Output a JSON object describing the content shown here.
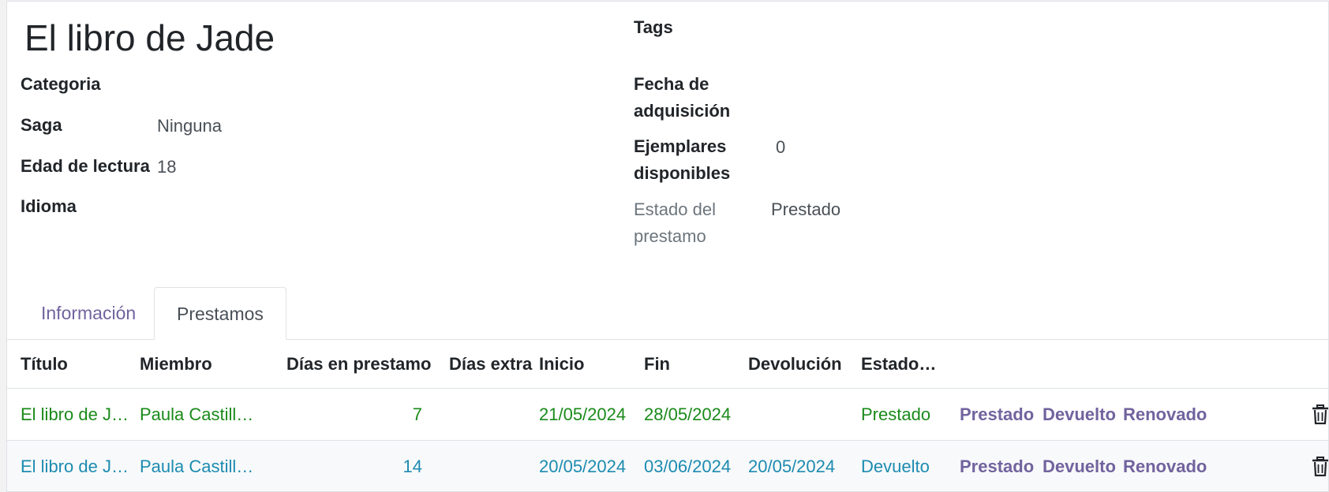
{
  "record": {
    "title": "El libro de Jade"
  },
  "fields_left": {
    "categoria_label": "Categoria",
    "saga_label": "Saga",
    "saga_value": "Ninguna",
    "edad_label": "Edad de lectura",
    "edad_value": "18",
    "idioma_label": "Idioma"
  },
  "fields_right": {
    "tags_label": "Tags",
    "fecha_label_1": "Fecha de",
    "fecha_label_2": "adquisición",
    "ejemplares_label_1": "Ejemplares",
    "ejemplares_label_2": "disponibles",
    "ejemplares_value": "0",
    "estado_label_1": "Estado del",
    "estado_label_2": "prestamo",
    "estado_value": "Prestado"
  },
  "tabs": [
    {
      "label": "Información",
      "active": false
    },
    {
      "label": "Prestamos",
      "active": true
    }
  ],
  "table": {
    "headers": [
      "Título",
      "Miembro",
      "Días en prestamo",
      "Días extra",
      "Inicio",
      "Fin",
      "Devolución",
      "Estado…"
    ],
    "rows": [
      {
        "titulo": "El libro de J…",
        "miembro": "Paula Castill…",
        "dias": "7",
        "extra": "",
        "inicio": "21/05/2024",
        "fin": "28/05/2024",
        "devolucion": "",
        "estado": "Prestado"
      },
      {
        "titulo": "El libro de J…",
        "miembro": "Paula Castill…",
        "dias": "14",
        "extra": "",
        "inicio": "20/05/2024",
        "fin": "03/06/2024",
        "devolucion": "20/05/2024",
        "estado": "Devuelto"
      }
    ],
    "actions": [
      "Prestado",
      "Devuelto",
      "Renovado"
    ],
    "delete_icon": "trash-icon"
  },
  "colors": {
    "accent": "#71639e",
    "row_prestado": "#1a8a1a",
    "row_devuelto": "#1c8bb0"
  }
}
